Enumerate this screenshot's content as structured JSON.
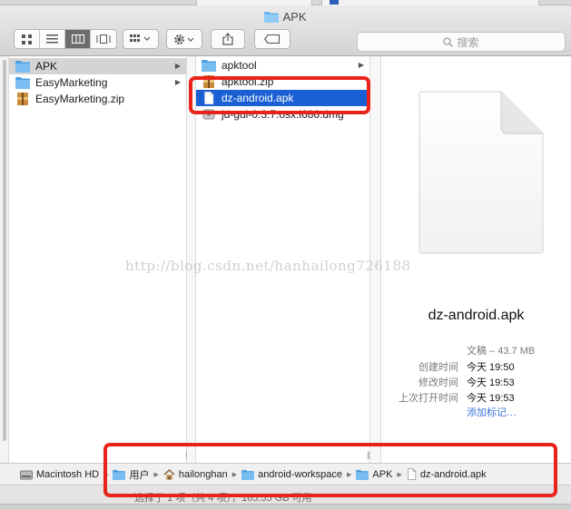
{
  "window": {
    "title": "APK"
  },
  "toolbar": {
    "search_placeholder": "搜索",
    "view_buttons": [
      "icon-view",
      "list-view",
      "column-view",
      "cover-flow-view"
    ]
  },
  "columns": {
    "first": [
      {
        "name": "APK",
        "type": "folder",
        "has_children": true,
        "selected": true
      },
      {
        "name": "EasyMarketing",
        "type": "folder",
        "has_children": true,
        "selected": false
      },
      {
        "name": "EasyMarketing.zip",
        "type": "zip",
        "has_children": false,
        "selected": false
      }
    ],
    "second": [
      {
        "name": "apktool",
        "type": "folder",
        "has_children": true,
        "selected": false
      },
      {
        "name": "apktool.zip",
        "type": "zip",
        "has_children": false,
        "selected": false
      },
      {
        "name": "dz-android.apk",
        "type": "file",
        "has_children": false,
        "selected": true
      },
      {
        "name": "jd-gui-0.3.7.osx.i686.dmg",
        "type": "dmg",
        "has_children": false,
        "selected": false
      }
    ]
  },
  "preview": {
    "file_name": "dz-android.apk",
    "kind_label": "文稿",
    "size": "43.7 MB",
    "created_label": "创建时间",
    "created_value": "今天 19:50",
    "modified_label": "修改时间",
    "modified_value": "今天 19:53",
    "opened_label": "上次打开时间",
    "opened_value": "今天 19:53",
    "add_tags": "添加标记…"
  },
  "watermark": "http://blog.csdn.net/hanhailong726188",
  "path_bar": [
    {
      "label": "Macintosh HD",
      "icon": "hard-drive-icon"
    },
    {
      "label": "用户",
      "icon": "folder-icon"
    },
    {
      "label": "hailonghan",
      "icon": "home-icon"
    },
    {
      "label": "android-workspace",
      "icon": "folder-icon"
    },
    {
      "label": "APK",
      "icon": "folder-icon"
    },
    {
      "label": "dz-android.apk",
      "icon": "document-icon"
    }
  ],
  "status_bar": {
    "text": "选择了 1 项（共 4 项），165.55 GB 可用"
  },
  "colors": {
    "selection": "#1a5fd3",
    "annotation": "#e8241a",
    "folder": "#6cb4ee"
  }
}
